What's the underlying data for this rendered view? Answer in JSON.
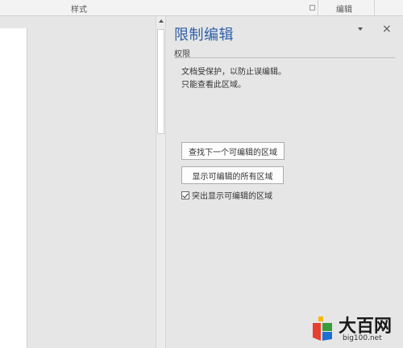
{
  "ribbon": {
    "styles_group_label": "样式",
    "editing_group_label": "编辑"
  },
  "pane": {
    "title": "限制编辑",
    "close_glyph": "×",
    "section_label": "权限",
    "info_line1": "文档受保护，以防止误编辑。",
    "info_line2": "只能查看此区域。",
    "find_next_button": "查找下一个可编辑的区域",
    "show_all_button": "显示可编辑的所有区域",
    "highlight_checkbox_label": "突出显示可编辑的区域",
    "highlight_checked": true
  },
  "watermark": {
    "brand_text": "大百网",
    "url_text": "big100.net",
    "colors": [
      "#e8402f",
      "#f5b800",
      "#3a9b3a",
      "#1d6fd1"
    ]
  }
}
